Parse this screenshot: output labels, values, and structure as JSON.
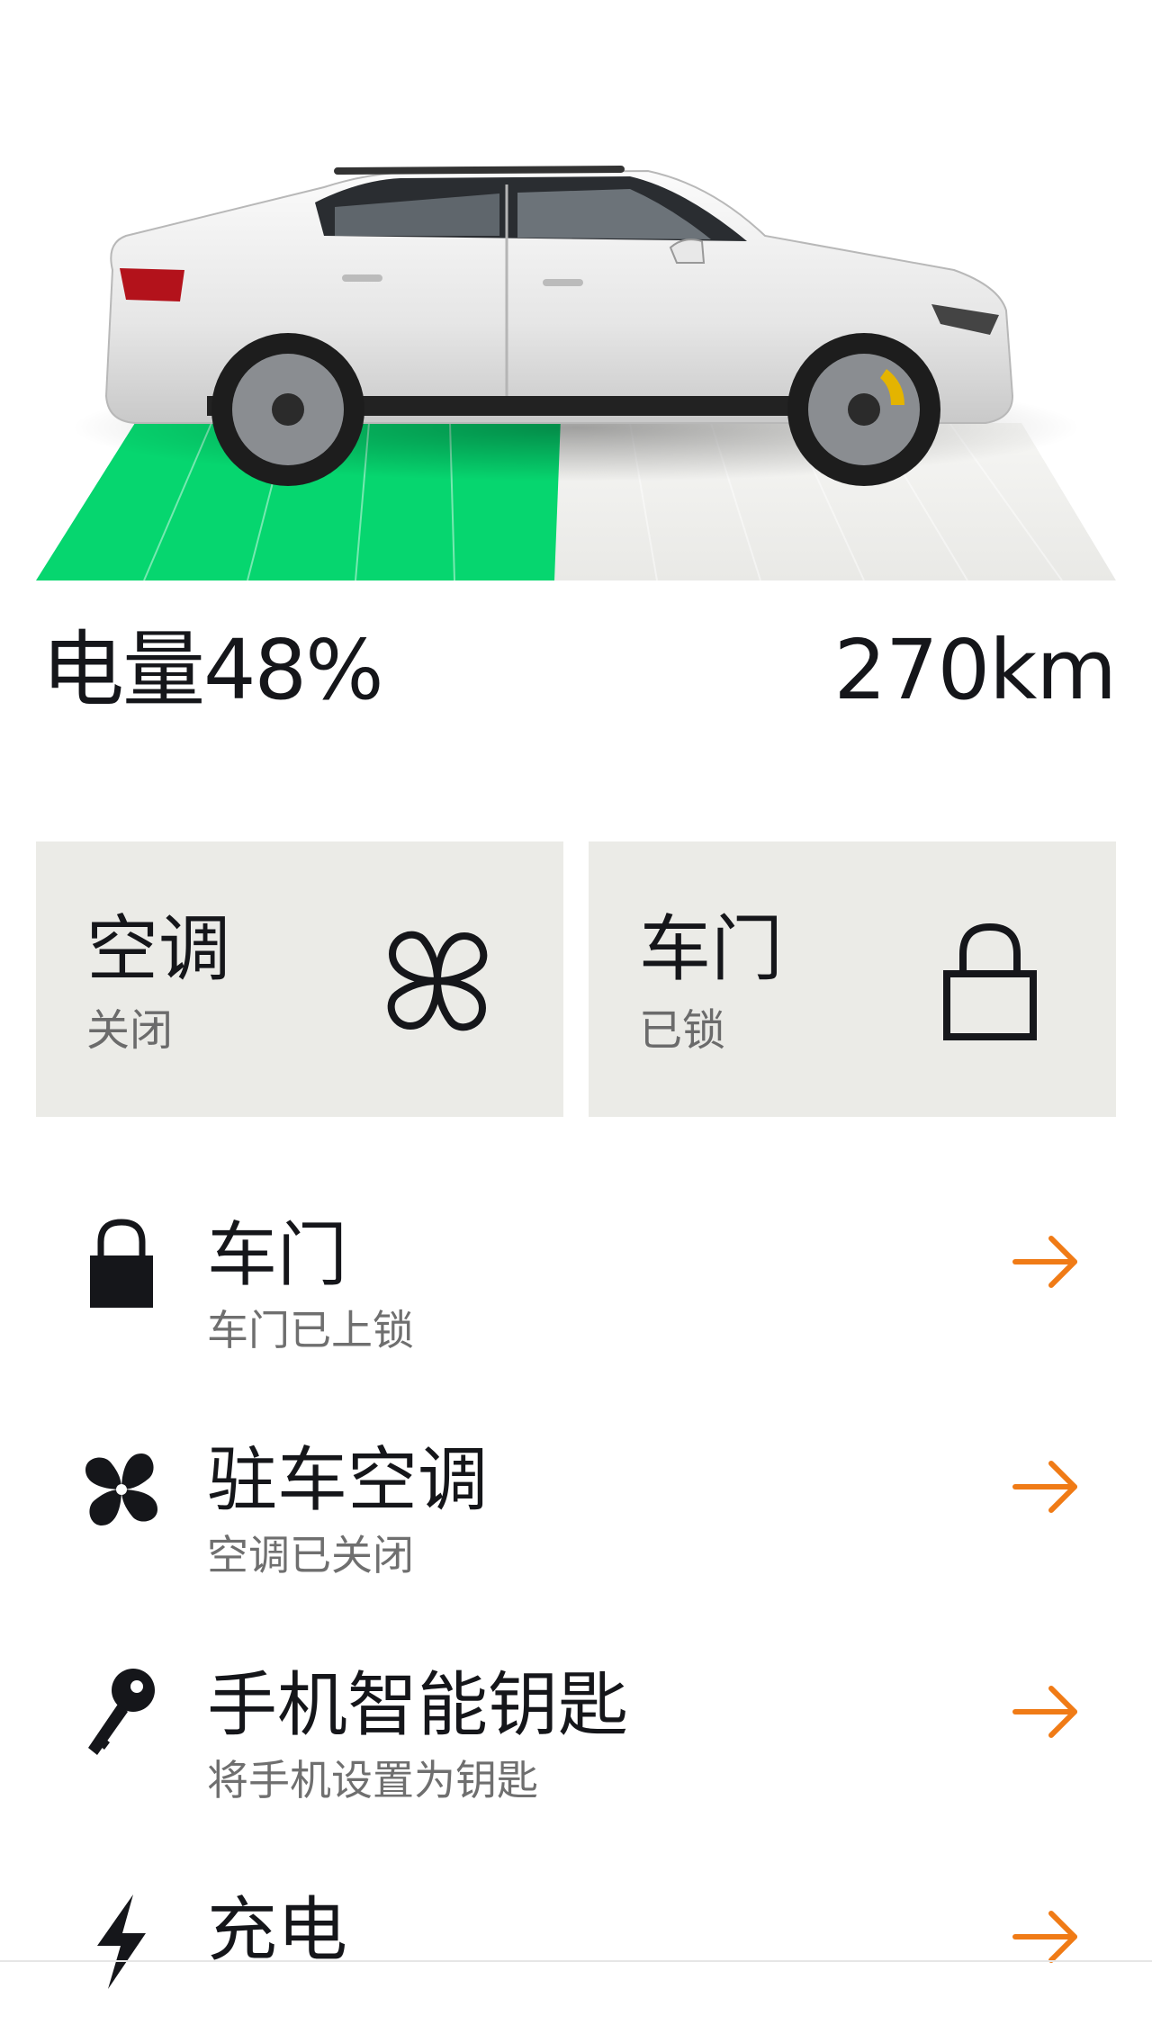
{
  "vehicle": {
    "battery_label": "电量48%",
    "battery_percent": 48,
    "range_label": "270km",
    "charge_color": "#06d66f"
  },
  "cards": [
    {
      "title": "空调",
      "status": "关闭",
      "icon": "fan-icon"
    },
    {
      "title": "车门",
      "status": "已锁",
      "icon": "padlock-outline-icon"
    }
  ],
  "list": [
    {
      "label": "车门",
      "sub": "车门已上锁",
      "icon": "padlock-icon"
    },
    {
      "label": "驻车空调",
      "sub": "空调已关闭",
      "icon": "fan-icon"
    },
    {
      "label": "手机智能钥匙",
      "sub": "将手机设置为钥匙",
      "icon": "key-icon"
    },
    {
      "label": "充电",
      "sub": "",
      "icon": "lightning-icon"
    }
  ],
  "accent_color": "#f07b16"
}
